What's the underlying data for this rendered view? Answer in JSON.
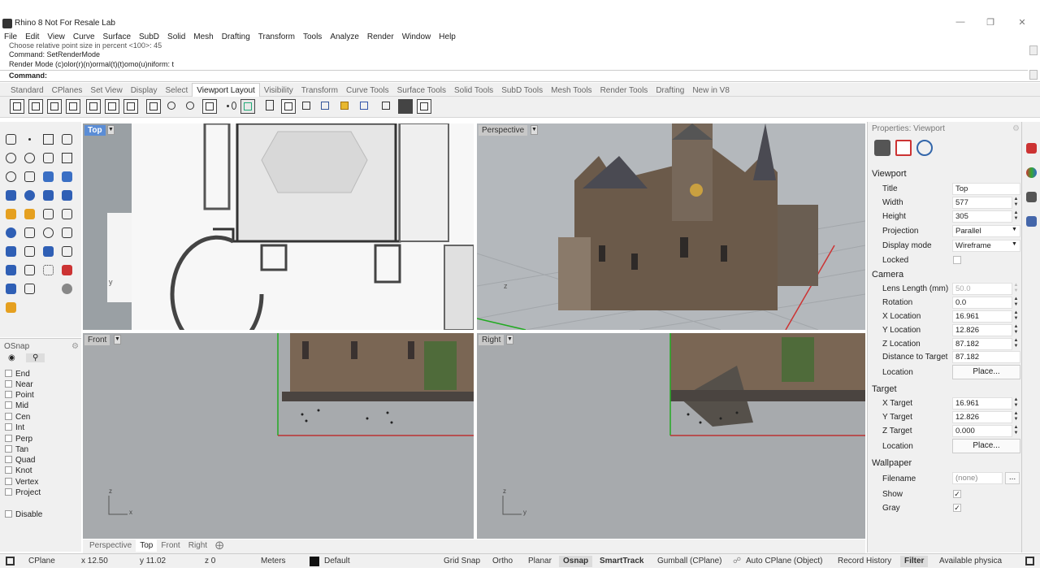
{
  "window": {
    "title": "Rhino 8 Not For Resale Lab"
  },
  "menus": [
    "File",
    "Edit",
    "View",
    "Curve",
    "Surface",
    "SubD",
    "Solid",
    "Mesh",
    "Drafting",
    "Transform",
    "Tools",
    "Analyze",
    "Render",
    "Window",
    "Help"
  ],
  "command": {
    "history": [
      "Choose relative point size in percent <100>: 45",
      "Command: SetRenderMode",
      "Render Mode (c)olor(r)(n)ormal(t)(t)omo(u)niform: t"
    ],
    "prompt": "Command:"
  },
  "tabs": [
    "Standard",
    "CPlanes",
    "Set View",
    "Display",
    "Select",
    "Viewport Layout",
    "Visibility",
    "Transform",
    "Curve Tools",
    "Surface Tools",
    "Solid Tools",
    "SubD Tools",
    "Mesh Tools",
    "Render Tools",
    "Drafting",
    "New in V8"
  ],
  "active_tab": "Viewport Layout",
  "viewports": {
    "top": "Top",
    "perspective": "Perspective",
    "front": "Front",
    "right": "Right"
  },
  "viewport_tabs": [
    "Perspective",
    "Top",
    "Front",
    "Right"
  ],
  "osnap": {
    "title": "OSnap",
    "items": [
      "End",
      "Near",
      "Point",
      "Mid",
      "Cen",
      "Int",
      "Perp",
      "Tan",
      "Quad",
      "Knot",
      "Vertex",
      "Project"
    ],
    "disable": "Disable"
  },
  "properties": {
    "header": "Properties: Viewport",
    "viewport_section": "Viewport",
    "title_label": "Title",
    "title_value": "Top",
    "width_label": "Width",
    "width_value": "577",
    "height_label": "Height",
    "height_value": "305",
    "projection_label": "Projection",
    "projection_value": "Parallel",
    "display_label": "Display mode",
    "display_value": "Wireframe",
    "locked_label": "Locked",
    "camera_section": "Camera",
    "lens_label": "Lens Length (mm)",
    "lens_value": "50.0",
    "rotation_label": "Rotation",
    "rotation_value": "0.0",
    "xloc_label": "X Location",
    "xloc_value": "16.961",
    "yloc_label": "Y Location",
    "yloc_value": "12.826",
    "zloc_label": "Z Location",
    "zloc_value": "87.182",
    "dist_label": "Distance to Target",
    "dist_value": "87.182",
    "location_label": "Location",
    "place_button": "Place...",
    "target_section": "Target",
    "xt_label": "X Target",
    "xt_value": "16.961",
    "yt_label": "Y Target",
    "yt_value": "12.826",
    "zt_label": "Z Target",
    "zt_value": "0.000",
    "wallpaper_section": "Wallpaper",
    "filename_label": "Filename",
    "filename_value": "(none)",
    "show_label": "Show",
    "gray_label": "Gray",
    "ellipsis": "..."
  },
  "status": {
    "cplane": "CPlane",
    "x": "x 12.50",
    "y": "y 11.02",
    "z": "z 0",
    "units": "Meters",
    "layer": "Default",
    "grid_snap": "Grid Snap",
    "ortho": "Ortho",
    "planar": "Planar",
    "osnap": "Osnap",
    "smarttrack": "SmartTrack",
    "gumball": "Gumball (CPlane)",
    "auto_cplane": "Auto CPlane (Object)",
    "record_history": "Record History",
    "filter": "Filter",
    "physical": "Available physica"
  },
  "axis_labels": {
    "x": "x",
    "y": "y",
    "z": "z"
  }
}
